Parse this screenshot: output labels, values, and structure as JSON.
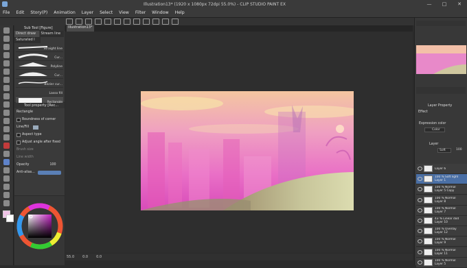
{
  "window": {
    "title": "Illustration13* (1920 x 1080px 72dpi 55.0%) - CLIP STUDIO PAINT EX",
    "controls": [
      "—",
      "□",
      "✕"
    ]
  },
  "menu": [
    "File",
    "Edit",
    "Story(P)",
    "Animation",
    "Layer",
    "Select",
    "View",
    "Filter",
    "Window",
    "Help"
  ],
  "canvas_tab": "Illustration13*",
  "subtool": {
    "header": "Sub Tool [Figure]",
    "tabs": [
      "Direct draw",
      "Stream line"
    ],
    "saturated_tab": "Saturated l",
    "brushes": [
      "Straight line",
      "Cur...",
      "Polyline",
      "Cur...",
      "Bezier cur...",
      "Lasso fill",
      "Rectangle"
    ]
  },
  "tool_property": {
    "header": "Tool property [Rec...",
    "shape_label": "Rectangle",
    "rows": [
      "Roundness of corner",
      "Line/Fill",
      "Aspect type",
      "Adjust angle after fixed",
      "Brush size",
      "Line width",
      "Opacity",
      "Anti-alias..."
    ],
    "opacity_value": "100"
  },
  "statusbar": {
    "zoom": "55.0",
    "angle": "0.0",
    "coord": "0.0"
  },
  "right_panel": {
    "layer_property_header": "Layer Property",
    "effect_label": "Effect",
    "expression_color_label": "Expression color",
    "expression_color_value": "Color",
    "layer_header": "Layer",
    "blend_mode": "Soft",
    "layer_opacity": "100",
    "layers": [
      {
        "line1": "",
        "line2": "Layer 6",
        "selected": false
      },
      {
        "line1": "100 % Soft light",
        "line2": "Layer 1",
        "selected": true
      },
      {
        "line1": "100 % Normal",
        "line2": "Layer 5 Copy",
        "selected": false
      },
      {
        "line1": "100 % Normal",
        "line2": "Layer 8",
        "selected": false
      },
      {
        "line1": "100 % Normal",
        "line2": "Layer 7",
        "selected": false
      },
      {
        "line1": "43 % Linear dod",
        "line2": "Layer 10",
        "selected": false
      },
      {
        "line1": "100 % Overlay",
        "line2": "Layer 12",
        "selected": false
      },
      {
        "line1": "100 % Normal",
        "line2": "Layer 9",
        "selected": false
      },
      {
        "line1": "100 % Normal",
        "line2": "Layer 11",
        "selected": false
      },
      {
        "line1": "100 % Normal",
        "line2": "Layer 5",
        "selected": false
      }
    ]
  },
  "colors": {
    "accent_selected_layer": "#4a6fa5",
    "main_color_swatch": "#f0c4e8",
    "sub_color_swatch": "#ffffff"
  }
}
